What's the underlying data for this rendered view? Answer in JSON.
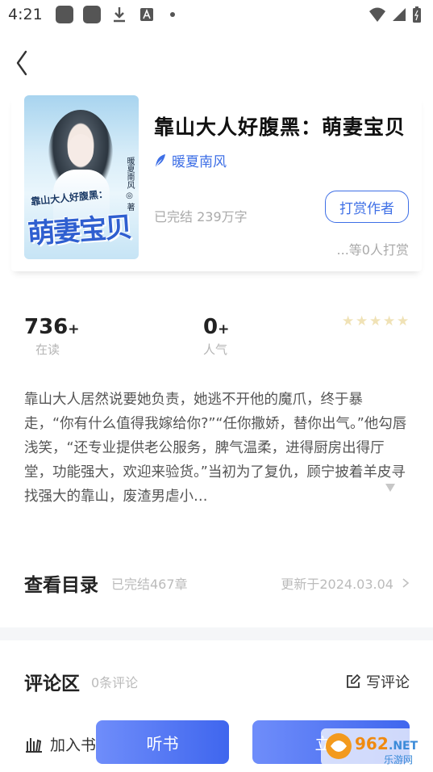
{
  "status_bar": {
    "time": "4:21"
  },
  "book": {
    "title": "靠山大人好腹黑：萌妻宝贝",
    "author": "暖夏南风",
    "status": "已完结 239万字",
    "cover": {
      "title": "萌妻宝贝",
      "subtitle": "靠山大人好腹黑：",
      "author": "暖夏南风 ◎ 著"
    },
    "reward_button": "打赏作者",
    "reward_count": "...等0人打赏"
  },
  "stats": {
    "readers": {
      "value": "736",
      "suffix": "+",
      "label": "在读"
    },
    "popularity": {
      "value": "0",
      "suffix": "+",
      "label": "人气"
    },
    "rating_stars": 0
  },
  "description": "靠山大人居然说要她负责，她逃不开他的魔爪，终于暴走，“你有什么值得我嫁给你?”“任你撒娇，替你出气。”他勾唇浅笑，“还专业提供老公服务，脾气温柔，进得厨房出得厅堂，功能强大，欢迎来验货。”当初为了复仇，顾宁披着羊皮寻找强大的靠山，废渣男虐小…",
  "catalog": {
    "title": "查看目录",
    "chapters": "已完结467章",
    "updated": "更新于2024.03.04"
  },
  "comments": {
    "title": "评论区",
    "count": "0条评论",
    "write_label": "写评论"
  },
  "bottom_bar": {
    "shelf_label": "加入书",
    "listen_label": "听书",
    "read_label": "立即"
  },
  "colors": {
    "accent": "#3e6fe6",
    "muted": "#b5b5b5",
    "star_empty": "#f0e2b6"
  }
}
